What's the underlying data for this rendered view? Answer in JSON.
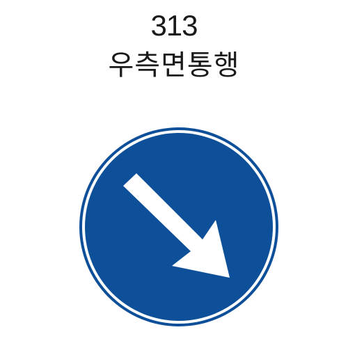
{
  "sign": {
    "code": "313",
    "name": "우측면통행",
    "colors": {
      "background": "#ffffff",
      "sign_blue": "#0e4f9a",
      "arrow": "#ffffff",
      "text": "#1a1a1a"
    },
    "icon": "diagonal-arrow-down-right"
  }
}
